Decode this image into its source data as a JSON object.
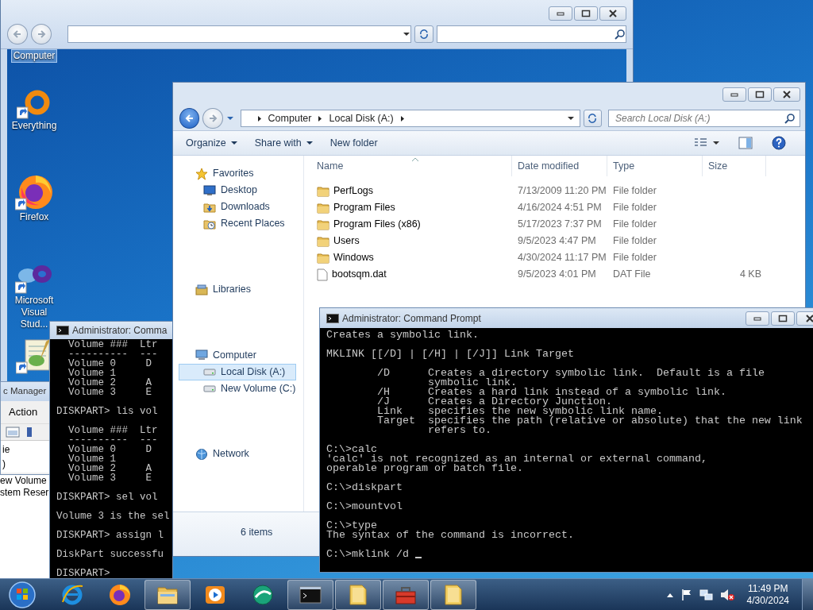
{
  "desktop_icons": [
    {
      "kind": "computer",
      "label": "Computer",
      "selected": true
    },
    {
      "kind": "everything",
      "label": "Everything",
      "selected": false
    },
    {
      "kind": "firefox",
      "label": "Firefox",
      "selected": false
    },
    {
      "kind": "vs",
      "label": "Microsoft Visual Stud...",
      "selected": false
    },
    {
      "kind": "notepad",
      "selected": false
    }
  ],
  "device_manager": {
    "title": "c Manager",
    "menu": [
      "Action"
    ],
    "list": [
      "ie",
      ")"
    ]
  },
  "disk_list": [
    "ew Volume",
    "stem Reser"
  ],
  "cmd_small": {
    "title": "Administrator: Comma",
    "paragraphs": [
      [
        "  Volume ###  Ltr",
        "  ----------  ---",
        "  Volume 0     D",
        "  Volume 1",
        "  Volume 2     A",
        "  Volume 3     E"
      ],
      [
        "DISKPART> lis vol"
      ],
      [
        "  Volume ###  Ltr",
        "  ----------  ---",
        "  Volume 0     D",
        "  Volume 1",
        "  Volume 2     A",
        "  Volume 3     E"
      ],
      [
        "DISKPART> sel vol"
      ],
      [
        "Volume 3 is the sel"
      ],
      [
        "DISKPART> assign l"
      ],
      [
        "DiskPart successfu"
      ],
      [
        "DISKPART>"
      ]
    ]
  },
  "explorer": {
    "breadcrumb": [
      "Computer",
      "Local Disk (A:)"
    ],
    "search": {
      "placeholder": "Search Local Disk (A:)"
    },
    "toolbar": [
      {
        "label": "Organize",
        "dropdown": true
      },
      {
        "label": "Share with",
        "dropdown": true
      },
      {
        "label": "New folder",
        "dropdown": false
      }
    ],
    "nav": [
      {
        "label": "Favorites",
        "kind": "star",
        "selected": false,
        "children": [
          {
            "label": "Desktop",
            "kind": "desktop",
            "selected": false
          },
          {
            "label": "Downloads",
            "kind": "downloads",
            "selected": false
          },
          {
            "label": "Recent Places",
            "kind": "recent",
            "selected": false
          }
        ]
      },
      {
        "label": "Libraries",
        "kind": "libraries",
        "selected": false
      },
      {
        "label": "Computer",
        "kind": "computer",
        "selected": false,
        "children": [
          {
            "label": "Local Disk (A:)",
            "kind": "disk",
            "selected": true
          },
          {
            "label": "New Volume (C:)",
            "kind": "disk",
            "selected": false
          }
        ]
      },
      {
        "label": "Network",
        "kind": "network",
        "selected": false
      }
    ],
    "columns": [
      "Name",
      "Date modified",
      "Type",
      "Size"
    ],
    "rows": [
      {
        "kind": "folder",
        "name": "PerfLogs",
        "date": "7/13/2009 11:20 PM",
        "type": "File folder"
      },
      {
        "kind": "folder",
        "name": "Program Files",
        "date": "4/16/2024 4:51 PM",
        "type": "File folder"
      },
      {
        "kind": "folder",
        "name": "Program Files (x86)",
        "date": "5/17/2023 7:37 PM",
        "type": "File folder"
      },
      {
        "kind": "folder",
        "name": "Users",
        "date": "9/5/2023 4:47 PM",
        "type": "File folder"
      },
      {
        "kind": "folder",
        "name": "Windows",
        "date": "4/30/2024 11:17 PM",
        "type": "File folder"
      },
      {
        "kind": "file",
        "name": "bootsqm.dat",
        "date": "9/5/2023 4:01 PM",
        "type": "DAT File",
        "size": "4 KB"
      }
    ],
    "status": "6 items"
  },
  "cmd_main": {
    "title": "Administrator: Command Prompt",
    "cursor": true,
    "paragraphs": [
      [
        "Creates a symbolic link."
      ],
      [
        "MKLINK [[/D] | [/H] | [/J]] Link Target"
      ],
      [
        "        /D      Creates a directory symbolic link.  Default is a file",
        "                symbolic link.",
        "        /H      Creates a hard link instead of a symbolic link.",
        "        /J      Creates a Directory Junction.",
        "        Link    specifies the new symbolic link name.",
        "        Target  specifies the path (relative or absolute) that the new link",
        "                refers to."
      ],
      [
        "C:\\>calc",
        "'calc' is not recognized as an internal or external command,",
        "operable program or batch file."
      ],
      [
        "C:\\>diskpart"
      ],
      [
        "C:\\>mountvol"
      ],
      [
        "C:\\>type",
        "The syntax of the command is incorrect."
      ],
      [
        "C:\\>mklink /d"
      ]
    ]
  },
  "taskbar": {
    "apps": [
      {
        "kind": "ie",
        "running": false
      },
      {
        "kind": "firefox",
        "running": false
      },
      {
        "kind": "explorer",
        "running": true
      },
      {
        "kind": "media",
        "running": false
      },
      {
        "kind": "green",
        "running": false
      },
      {
        "kind": "cmd",
        "running": true
      },
      {
        "kind": "folder",
        "running": true
      },
      {
        "kind": "toolbox",
        "running": true
      },
      {
        "kind": "folder",
        "running": true
      }
    ],
    "time": "11:49 PM",
    "date": "4/30/2024"
  }
}
